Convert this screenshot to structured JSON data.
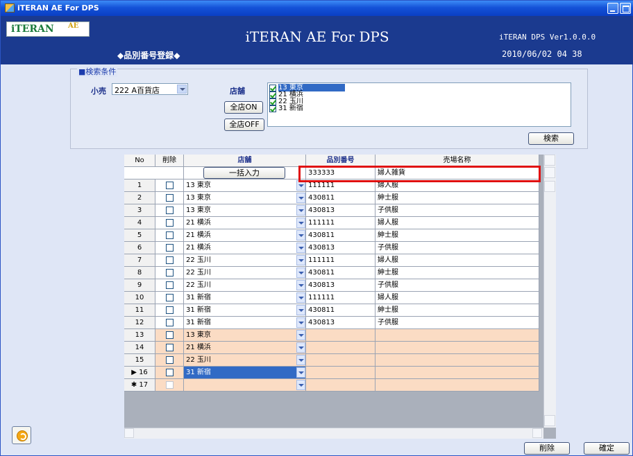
{
  "window": {
    "title": "iTERAN AE For DPS"
  },
  "header": {
    "logo_text": "iTERAN",
    "logo_ae": "AE",
    "app_title": "iTERAN AE For DPS",
    "sub_title": "◆品別番号登録◆",
    "version": "iTERAN DPS Ver1.0.0.0",
    "datetime": "2010/06/02 04 38"
  },
  "search": {
    "legend": "■検索条件",
    "retail_label": "小売",
    "retail_value": "222 A百貨店",
    "store_label": "店舗",
    "all_on_label": "全店ON",
    "all_off_label": "全店OFF",
    "search_label": "検索",
    "stores": [
      {
        "label": "13 東京",
        "checked": true,
        "selected": true
      },
      {
        "label": "21 横浜",
        "checked": true,
        "selected": false
      },
      {
        "label": "22 玉川",
        "checked": true,
        "selected": false
      },
      {
        "label": "31 新宿",
        "checked": true,
        "selected": false
      }
    ]
  },
  "grid": {
    "headers": {
      "no": "No",
      "delete": "削除",
      "store": "店舗",
      "product_no": "品別番号",
      "floor_name": "売場名称"
    },
    "bulk_button": "一括入力",
    "bulk_product_no": "333333",
    "bulk_floor_name": "婦人雑貨",
    "rows": [
      {
        "no": "1",
        "store": "13 東京",
        "product_no": "111111",
        "floor_name": "婦人服"
      },
      {
        "no": "2",
        "store": "13 東京",
        "product_no": "430811",
        "floor_name": "紳士服"
      },
      {
        "no": "3",
        "store": "13 東京",
        "product_no": "430813",
        "floor_name": "子供服"
      },
      {
        "no": "4",
        "store": "21 横浜",
        "product_no": "111111",
        "floor_name": "婦人服"
      },
      {
        "no": "5",
        "store": "21 横浜",
        "product_no": "430811",
        "floor_name": "紳士服"
      },
      {
        "no": "6",
        "store": "21 横浜",
        "product_no": "430813",
        "floor_name": "子供服"
      },
      {
        "no": "7",
        "store": "22 玉川",
        "product_no": "111111",
        "floor_name": "婦人服"
      },
      {
        "no": "8",
        "store": "22 玉川",
        "product_no": "430811",
        "floor_name": "紳士服"
      },
      {
        "no": "9",
        "store": "22 玉川",
        "product_no": "430813",
        "floor_name": "子供服"
      },
      {
        "no": "10",
        "store": "31 新宿",
        "product_no": "111111",
        "floor_name": "婦人服"
      },
      {
        "no": "11",
        "store": "31 新宿",
        "product_no": "430811",
        "floor_name": "紳士服"
      },
      {
        "no": "12",
        "store": "31 新宿",
        "product_no": "430813",
        "floor_name": "子供服"
      },
      {
        "no": "13",
        "store": "13 東京",
        "product_no": "",
        "floor_name": ""
      },
      {
        "no": "14",
        "store": "21 横浜",
        "product_no": "",
        "floor_name": ""
      },
      {
        "no": "15",
        "store": "22 玉川",
        "product_no": "",
        "floor_name": ""
      },
      {
        "no": "▶ 16",
        "store": "31 新宿",
        "product_no": "",
        "floor_name": ""
      },
      {
        "no": "✱ 17",
        "store": "",
        "product_no": "",
        "floor_name": ""
      }
    ]
  },
  "footer": {
    "delete_label": "削除",
    "confirm_label": "確定"
  },
  "colors": {
    "header_bg": "#1b3a8f",
    "new_row_bg": "#fbdcc4",
    "selected_bg": "#316ac5",
    "highlight": "#e01010"
  }
}
